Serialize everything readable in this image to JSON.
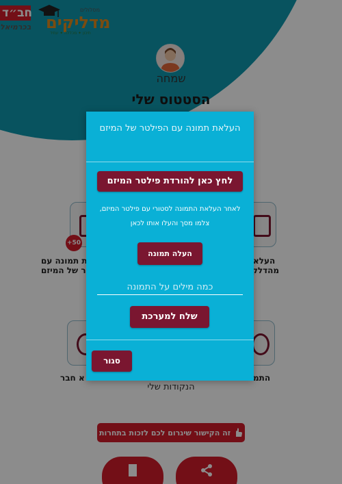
{
  "header": {
    "logo_chabad_text": "חב״ד",
    "logo_chabad_sub": "בכרמיאל",
    "logo_madlikim_small": "מסלולים",
    "logo_madlikim_word": "מדליקים",
    "logo_madlikim_sub": "תיכון ✦ מכללה ✦ עתיד"
  },
  "profile": {
    "user_name": "שמחה",
    "status_title": "הסטטוס שלי"
  },
  "tiles": [
    {
      "label_line1": "העלאת תמונה עם",
      "label_line2": "הפילטר של המיזם",
      "badge": "+50"
    },
    {
      "label_line1": "העלא",
      "label_line2": "מהדלק"
    },
    {
      "label": "א חבר"
    },
    {
      "label": "התמ"
    }
  ],
  "points_label": "הנקודות שלי",
  "link_button_label": "זה הקישור שיגרום לכם לזכות בתחרות",
  "modal": {
    "title": "העלאת תמונה עם הפילטר של המיזם",
    "download_filter_button": "לחץ כאן להורדת פילטר המיזם",
    "instructions": "לאחר העלאת התמונה לסטורי עם פילטר המיזם, צלמו מסך והעלו אותו לכאן",
    "upload_button": "העלה תמונה",
    "caption_placeholder": "כמה מילים על התמונה",
    "send_button": "שלח למערכת",
    "close_button": "סגור"
  },
  "colors": {
    "teal": "#0f97ad",
    "modal_bg": "#0ab0d6",
    "button_dark": "#7a1630",
    "brand_red": "#d21c2b"
  }
}
